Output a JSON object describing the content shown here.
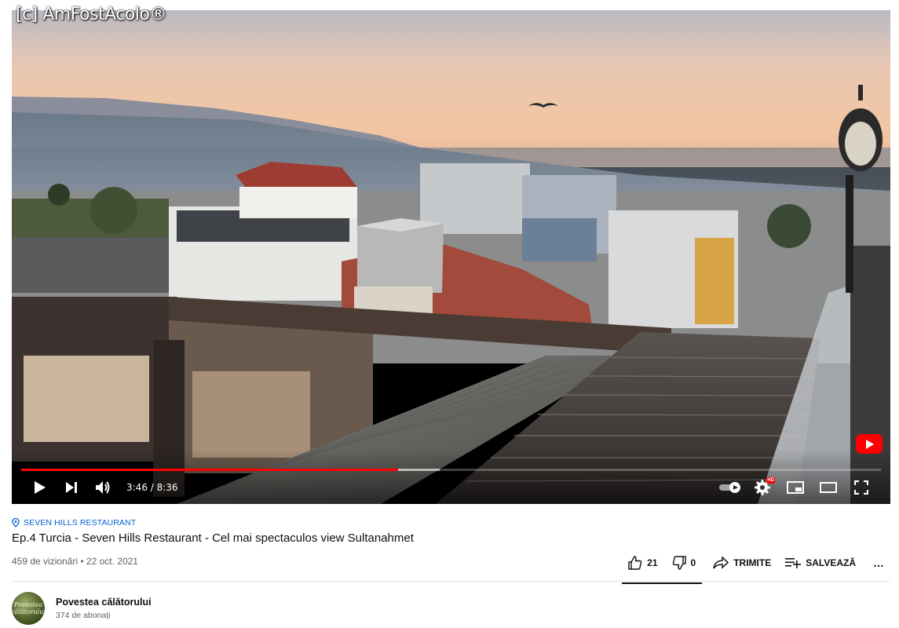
{
  "watermark": "[c] AmFostAcolo®",
  "player": {
    "current_time": "3:46",
    "duration": "8:36",
    "time_display": "3:46 / 8:36",
    "progress_fraction": 0.438,
    "buffered_fraction": 0.487,
    "progress_color": "#ff0000",
    "icons": {
      "play": "play-icon",
      "next": "next-icon",
      "volume": "volume-icon",
      "autoplay": "autoplay-toggle-icon",
      "settings": "gear-icon",
      "hd_badge": "HD",
      "miniplayer": "miniplayer-icon",
      "theater": "theater-mode-icon",
      "fullscreen": "fullscreen-icon",
      "logo": "youtube-logo-icon"
    }
  },
  "video": {
    "location": "SEVEN HILLS RESTAURANT",
    "title": "Ep.4 Turcia - Seven Hills Restaurant - Cel mai spectaculos view Sultanahmet",
    "meta": "459 de vizionări • 22 oct. 2021",
    "likes": "21",
    "dislikes": "0",
    "share_label": "TRIMITE",
    "save_label": "SALVEAZĂ",
    "more_label": "…"
  },
  "channel": {
    "name": "Povestea călătorului",
    "subscribers": "374 de abonați",
    "avatar_text": "Povestea călătorului"
  },
  "colors": {
    "link": "#065fd4",
    "secondary_text": "#606060",
    "primary_text": "#0f0f0f"
  }
}
